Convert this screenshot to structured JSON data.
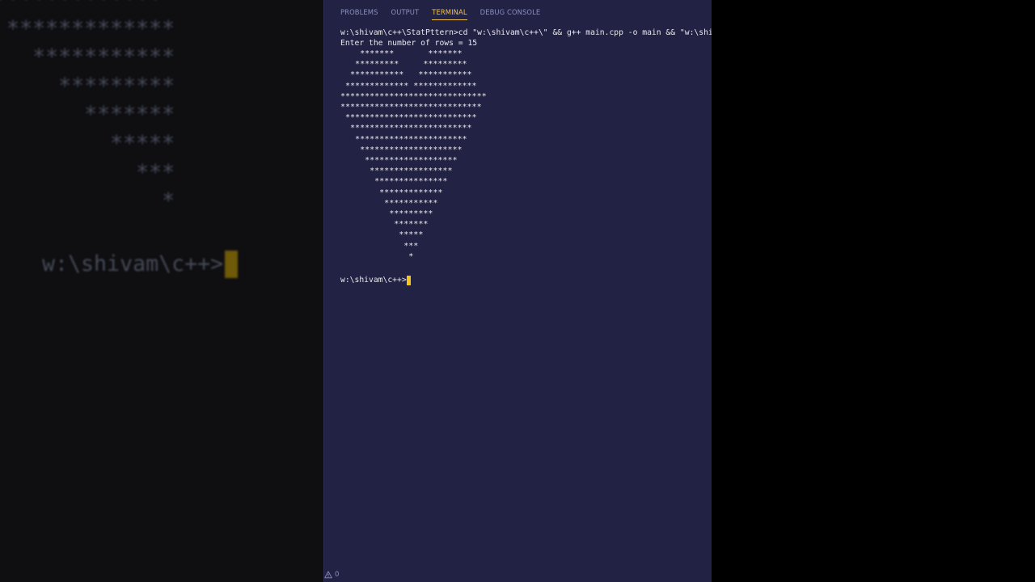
{
  "zoom_view": {
    "pattern_lines": [
      "  ***************",
      "     *************",
      "       ***********",
      "         *********",
      "           *******",
      "             *****",
      "               ***",
      "                 *"
    ],
    "prompt": "w:\\shivam\\c++>",
    "cursor_color": "#6e5a08"
  },
  "terminal_panel": {
    "tabs": [
      {
        "label": "PROBLEMS",
        "active": false
      },
      {
        "label": "OUTPUT",
        "active": false
      },
      {
        "label": "TERMINAL",
        "active": true
      },
      {
        "label": "DEBUG CONSOLE",
        "active": false
      }
    ],
    "command_line": "w:\\shivam\\c++\\StatPttern>cd \"w:\\shivam\\c++\\\" && g++ main.cpp -o main && \"w:\\shivam\\c++\\\"main",
    "input_prompt": "Enter the number of rows = 15",
    "pattern_output": [
      "    *******       *******",
      "   *********     *********",
      "  ***********   ***********",
      " ************* *************",
      "******************************",
      "*****************************",
      " ***************************",
      "  *************************",
      "   ***********************",
      "    *********************",
      "     *******************",
      "      *****************",
      "       ***************",
      "        *************",
      "         ***********",
      "          *********",
      "           *******",
      "            *****",
      "             ***",
      "              *"
    ],
    "final_prompt": "w:\\shivam\\c++>",
    "accent_color": "#f2c14e",
    "background_color": "#222244"
  },
  "status_bar": {
    "problems_icon": "warning-icon",
    "problems_count": "0"
  }
}
